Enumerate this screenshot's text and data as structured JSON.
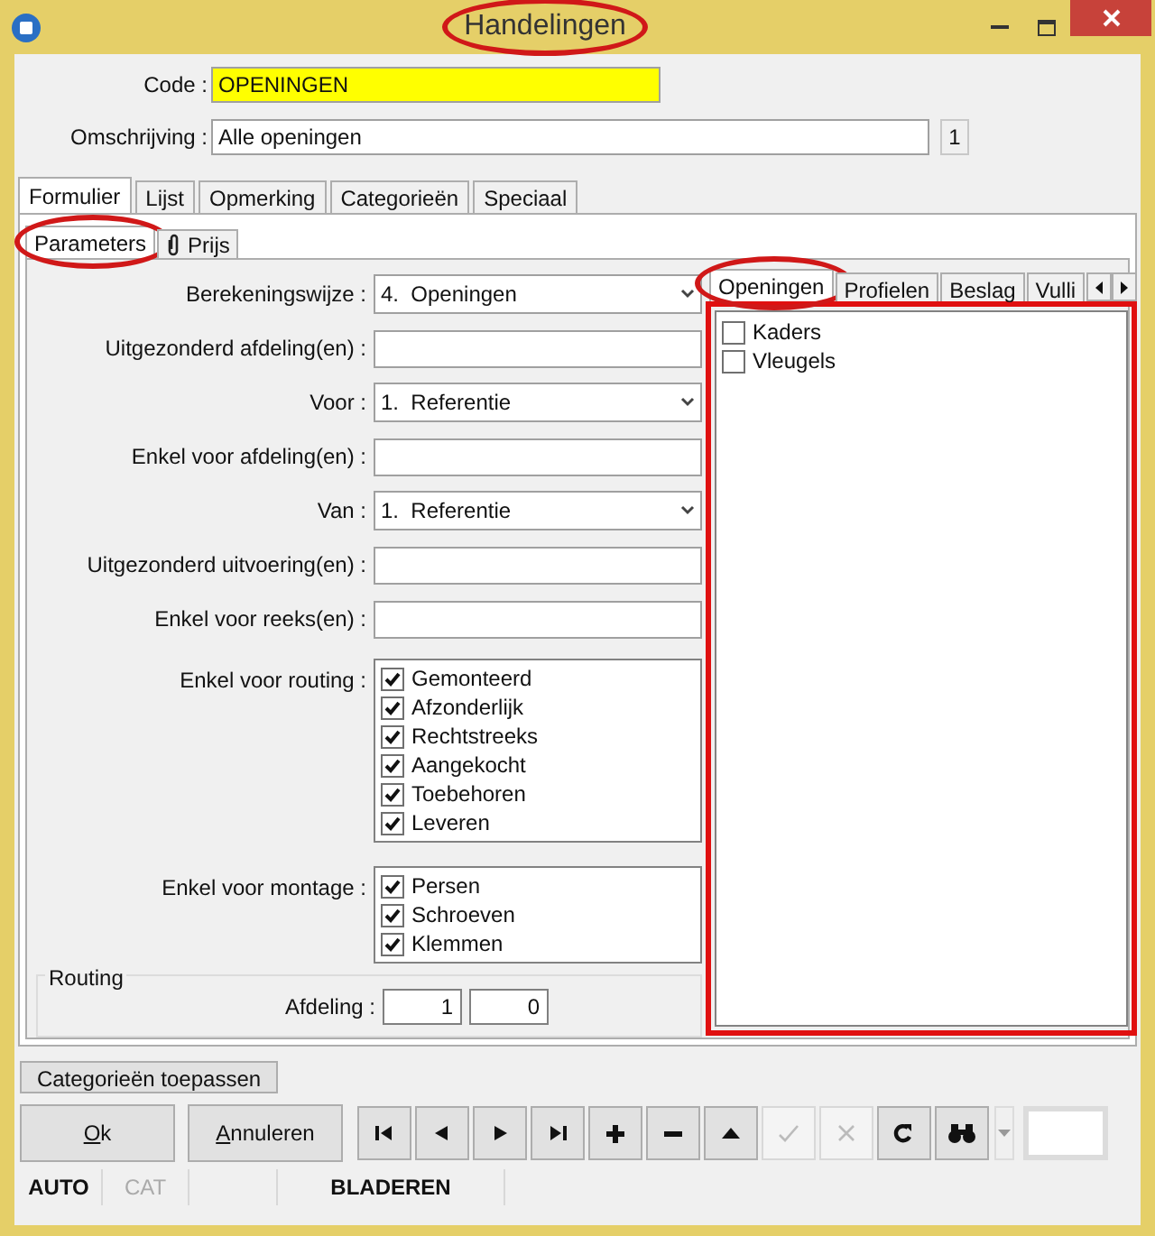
{
  "window": {
    "title": "Handelingen"
  },
  "code": {
    "label": "Code :",
    "value": "OPENINGEN"
  },
  "omschrijving": {
    "label": "Omschrijving :",
    "value": "Alle openingen",
    "counter": "1"
  },
  "tabs": [
    {
      "label": "Formulier",
      "selected": true
    },
    {
      "label": "Lijst",
      "selected": false
    },
    {
      "label": "Opmerking",
      "selected": false
    },
    {
      "label": "Categorieën",
      "selected": false
    },
    {
      "label": "Speciaal",
      "selected": false
    }
  ],
  "subtabs": [
    {
      "label": "Parameters",
      "selected": true,
      "kind": "text"
    },
    {
      "label": "Prijs",
      "selected": false,
      "kind": "attachment"
    }
  ],
  "fields": [
    {
      "label": "Berekeningswijze :",
      "kind": "select",
      "value": "4.  Openingen"
    },
    {
      "label": "Uitgezonderd afdeling(en) :",
      "kind": "text"
    },
    {
      "label": "Voor :",
      "kind": "select",
      "value": "1.  Referentie"
    },
    {
      "label": "Enkel voor afdeling(en) :",
      "kind": "text"
    },
    {
      "label": "Van :",
      "kind": "select",
      "value": "1.  Referentie"
    },
    {
      "label": "Uitgezonderd uitvoering(en) :",
      "kind": "text"
    },
    {
      "label": "Enkel voor reeks(en) :",
      "kind": "text"
    }
  ],
  "checklists": [
    {
      "label": "Enkel voor routing :",
      "items": [
        {
          "label": "Gemonteerd",
          "checked": true
        },
        {
          "label": "Afzonderlijk",
          "checked": true
        },
        {
          "label": "Rechtstreeks",
          "checked": true
        },
        {
          "label": "Aangekocht",
          "checked": true
        },
        {
          "label": "Toebehoren",
          "checked": true
        },
        {
          "label": "Leveren",
          "checked": true
        }
      ]
    },
    {
      "label": "Enkel voor montage :",
      "items": [
        {
          "label": "Persen",
          "checked": true
        },
        {
          "label": "Schroeven",
          "checked": true
        },
        {
          "label": "Klemmen",
          "checked": true
        }
      ]
    }
  ],
  "routing": {
    "title": "Routing",
    "label": "Afdeling :",
    "values": [
      "1",
      "0"
    ]
  },
  "right_tabs": [
    {
      "label": "Openingen",
      "selected": true
    },
    {
      "label": "Profielen",
      "selected": false
    },
    {
      "label": "Beslag",
      "selected": false
    },
    {
      "label": "Vulli",
      "selected": false
    }
  ],
  "right_list": [
    {
      "label": "Kaders",
      "checked": false
    },
    {
      "label": "Vleugels",
      "checked": false
    }
  ],
  "apply_button": "Categorieën toepassen",
  "buttons": [
    "Ok",
    "Annuleren"
  ],
  "nav_buttons": [
    {
      "kind": "first",
      "disabled": false
    },
    {
      "kind": "prev",
      "disabled": false
    },
    {
      "kind": "next",
      "disabled": false
    },
    {
      "kind": "last",
      "disabled": false
    },
    {
      "kind": "add",
      "disabled": false
    },
    {
      "kind": "remove",
      "disabled": false
    },
    {
      "kind": "up",
      "disabled": false
    },
    {
      "kind": "confirm",
      "disabled": true
    },
    {
      "kind": "cancel",
      "disabled": true
    },
    {
      "kind": "refresh",
      "disabled": false
    },
    {
      "kind": "find",
      "disabled": false
    }
  ],
  "status_bar": [
    {
      "label": "AUTO",
      "disabled": false
    },
    {
      "label": "CAT",
      "disabled": true
    },
    {
      "label": "BLADEREN",
      "disabled": false
    }
  ]
}
